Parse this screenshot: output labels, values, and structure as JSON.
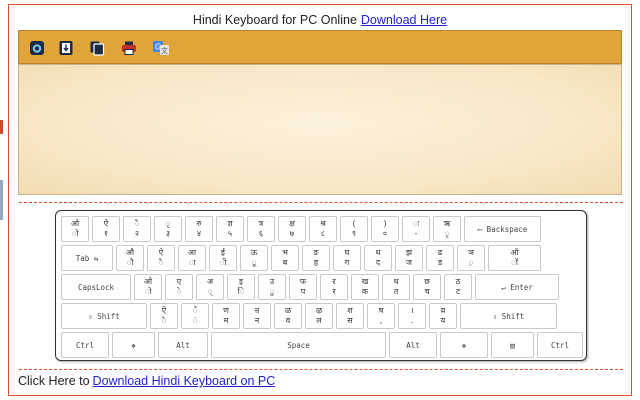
{
  "header": {
    "text": "Hindi Keyboard for PC Online",
    "link": "Download Here"
  },
  "toolbar": {
    "buttons": [
      {
        "icon": "save-icon"
      },
      {
        "icon": "download-file-icon"
      },
      {
        "icon": "copy-icon"
      },
      {
        "icon": "print-icon"
      },
      {
        "icon": "translate-icon"
      }
    ]
  },
  "editor": {
    "value": "",
    "placeholder": ""
  },
  "keyboard": {
    "rows": [
      [
        {
          "t": "ओ",
          "b": "ो"
        },
        {
          "t": "ऐ",
          "b": "१"
        },
        {
          "t": "ै",
          "b": "२"
        },
        {
          "t": "ृ",
          "b": "३"
        },
        {
          "t": "रु",
          "b": "४"
        },
        {
          "t": "ज्ञ",
          "b": "५"
        },
        {
          "t": "त्र",
          "b": "६"
        },
        {
          "t": "क्ष",
          "b": "७"
        },
        {
          "t": "श्र",
          "b": "८"
        },
        {
          "t": "(",
          "b": "९"
        },
        {
          "t": ")",
          "b": "०"
        },
        {
          "t": "ः",
          "b": "-"
        },
        {
          "t": "ऋ",
          "b": "ृ"
        },
        {
          "fn": "⟵ Backspace"
        }
      ],
      [
        {
          "fn": "Tab ⇆"
        },
        {
          "t": "औ",
          "b": "ौ"
        },
        {
          "t": "ऐ",
          "b": "ै"
        },
        {
          "t": "आ",
          "b": "ा"
        },
        {
          "t": "ई",
          "b": "ी"
        },
        {
          "t": "ऊ",
          "b": "ू"
        },
        {
          "t": "भ",
          "b": "ब"
        },
        {
          "t": "ङ",
          "b": "ह"
        },
        {
          "t": "घ",
          "b": "ग"
        },
        {
          "t": "ध",
          "b": "द"
        },
        {
          "t": "झ",
          "b": "ज"
        },
        {
          "t": "ढ",
          "b": "ड"
        },
        {
          "t": "ञ",
          "b": "़"
        },
        {
          "t": "ऑ",
          "b": "ॉ"
        }
      ],
      [
        {
          "fn": "CapsLock"
        },
        {
          "t": "ओ",
          "b": "ो"
        },
        {
          "t": "ए",
          "b": "े"
        },
        {
          "t": "अ",
          "b": "्"
        },
        {
          "t": "इ",
          "b": "ि"
        },
        {
          "t": "उ",
          "b": "ु"
        },
        {
          "t": "फ",
          "b": "प"
        },
        {
          "t": "ऱ",
          "b": "र"
        },
        {
          "t": "ख",
          "b": "क"
        },
        {
          "t": "थ",
          "b": "त"
        },
        {
          "t": "छ",
          "b": "च"
        },
        {
          "t": "ठ",
          "b": "ट"
        },
        {
          "fn": "↵ Enter"
        }
      ],
      [
        {
          "fn": "⇧ Shift"
        },
        {
          "t": "ऎ",
          "b": "ॆ"
        },
        {
          "t": "ँ",
          "b": "ं"
        },
        {
          "t": "ण",
          "b": "म"
        },
        {
          "t": "ऩ",
          "b": "न"
        },
        {
          "t": "ळ",
          "b": "व"
        },
        {
          "t": "ऴ",
          "b": "ल"
        },
        {
          "t": "श",
          "b": "स"
        },
        {
          "t": "ष",
          "b": ","
        },
        {
          "t": "।",
          "b": "."
        },
        {
          "t": "य़",
          "b": "य"
        },
        {
          "fn": "⇧ Shift"
        }
      ],
      [
        {
          "fn": "Ctrl"
        },
        {
          "fn": "❖"
        },
        {
          "fn": "Alt"
        },
        {
          "fn": "Space"
        },
        {
          "fn": "Alt"
        },
        {
          "fn": "❖"
        },
        {
          "fn": "▤"
        },
        {
          "fn": "Ctrl"
        }
      ]
    ]
  },
  "footer": {
    "text": "Click Here to",
    "link": "Download Hindi Keyboard on PC"
  },
  "colors": {
    "toolbar": "#dfa43a",
    "border": "#d9522c",
    "link": "#2222cc",
    "editor_bg": "#f8e7c6"
  }
}
